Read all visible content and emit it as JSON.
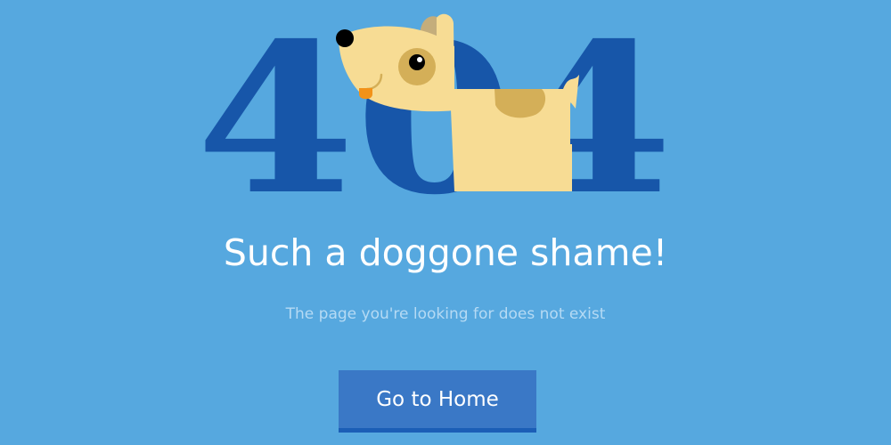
{
  "illustration": {
    "error_code": "404",
    "colors": {
      "background": "#56a8df",
      "digits": "#1756a9",
      "dog_body": "#f7dc94",
      "dog_spot": "#d4af58",
      "dog_ear": "#c4ad7b",
      "dog_nose": "#000000",
      "dog_tongue": "#f29219"
    }
  },
  "message": {
    "title": "Such a doggone shame!",
    "subtitle": "The page you're looking for does not exist"
  },
  "actions": {
    "home_label": "Go to Home",
    "button_color": "#3a78c6",
    "button_border_color": "#1b5eb6"
  }
}
